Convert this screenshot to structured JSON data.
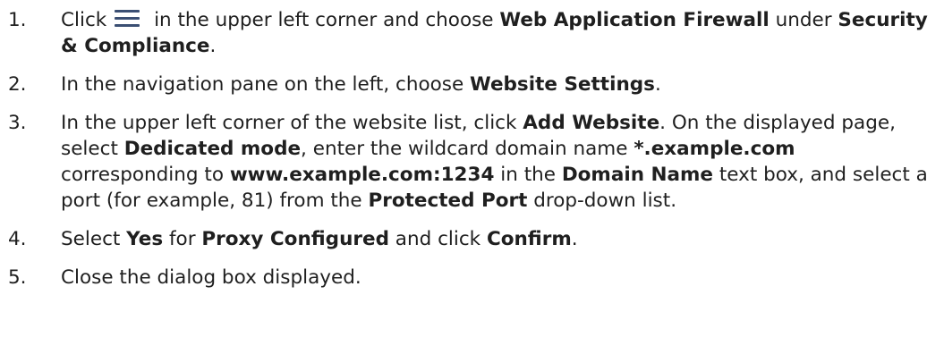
{
  "steps": [
    {
      "num": "1.",
      "t1": "Click",
      "icon": "hamburger-menu-icon",
      "t2": " in the upper left corner and choose ",
      "b1": "Web Application Firewall",
      "t3": " under ",
      "b2": "Security & Compliance",
      "t4": "."
    },
    {
      "num": "2.",
      "t1": "In the navigation pane on the left, choose ",
      "b1": "Website Settings",
      "t2": "."
    },
    {
      "num": "3.",
      "t1": "In the upper left corner of the website list, click ",
      "b1": "Add Website",
      "t2": ". On the displayed page, select ",
      "b2": "Dedicated mode",
      "t3": ", enter the wildcard domain name ",
      "b3": "*.example.com",
      "t4": " corresponding to ",
      "b4": "www.example.com:1234",
      "t5": " in the ",
      "b5": "Domain Name",
      "t6": " text box, and select a port (for example, 81) from the ",
      "b6": "Protected Port",
      "t7": " drop-down list."
    },
    {
      "num": "4.",
      "t1": "Select ",
      "b1": "Yes",
      "t2": " for ",
      "b2": "Proxy Configured",
      "t3": " and click ",
      "b3": "Confirm",
      "t4": "."
    },
    {
      "num": "5.",
      "t1": "Close the dialog box displayed."
    }
  ]
}
